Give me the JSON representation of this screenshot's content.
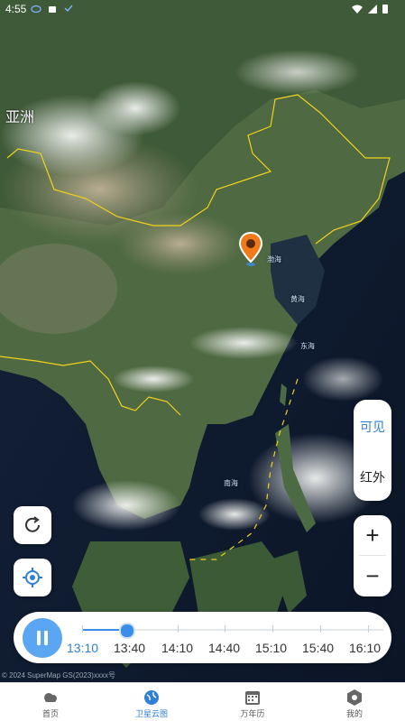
{
  "status_bar": {
    "time": "4:55"
  },
  "map": {
    "region_label": "亚洲",
    "sea_labels": [
      "渤海",
      "黄海",
      "东海",
      "南海"
    ]
  },
  "controls": {
    "refresh_icon": "refresh-icon",
    "locate_icon": "locate-icon",
    "layer_visible": "可见",
    "layer_infrared": "红外",
    "zoom_in": "+",
    "zoom_out": "−"
  },
  "timeline": {
    "times": [
      "13:10",
      "13:40",
      "14:10",
      "14:40",
      "15:10",
      "15:40",
      "16:10"
    ],
    "active_time": "13:10",
    "progress_fraction": 0.15
  },
  "attribution": "© 2024 SuperMap GS(2023)xxxx号",
  "tabs": [
    {
      "label": "首页",
      "icon": "cloud-icon"
    },
    {
      "label": "卫星云图",
      "icon": "globe-icon"
    },
    {
      "label": "万年历",
      "icon": "calendar-icon"
    },
    {
      "label": "我的",
      "icon": "hexagon-icon"
    }
  ],
  "colors": {
    "accent": "#2f7fd6",
    "play_button": "#5aa6f2",
    "border_line": "#f2d21a",
    "pin": "#f07a1a"
  }
}
